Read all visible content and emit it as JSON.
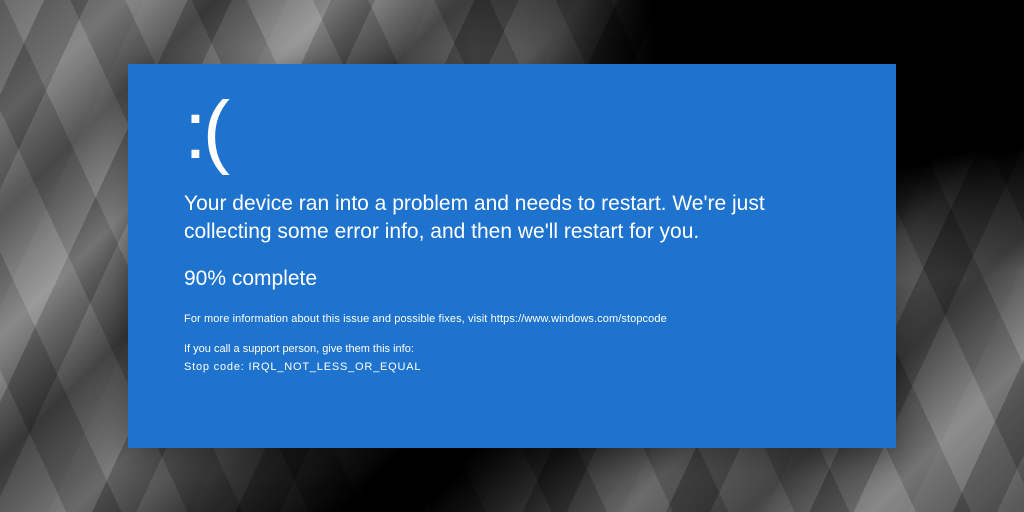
{
  "bsod": {
    "sad_face": ":(",
    "message": "Your device ran into a problem and needs to restart. We're just collecting some error info, and then we'll restart for you.",
    "progress": "90% complete",
    "more_info": "For more information about this issue and possible fixes, visit https://www.windows.com/stopcode",
    "support_label": "If you call a support person, give them this info:",
    "stop_code": "Stop code: IRQL_NOT_LESS_OR_EQUAL",
    "bg_color": "#1e73cf",
    "text_color": "#ffffff"
  }
}
